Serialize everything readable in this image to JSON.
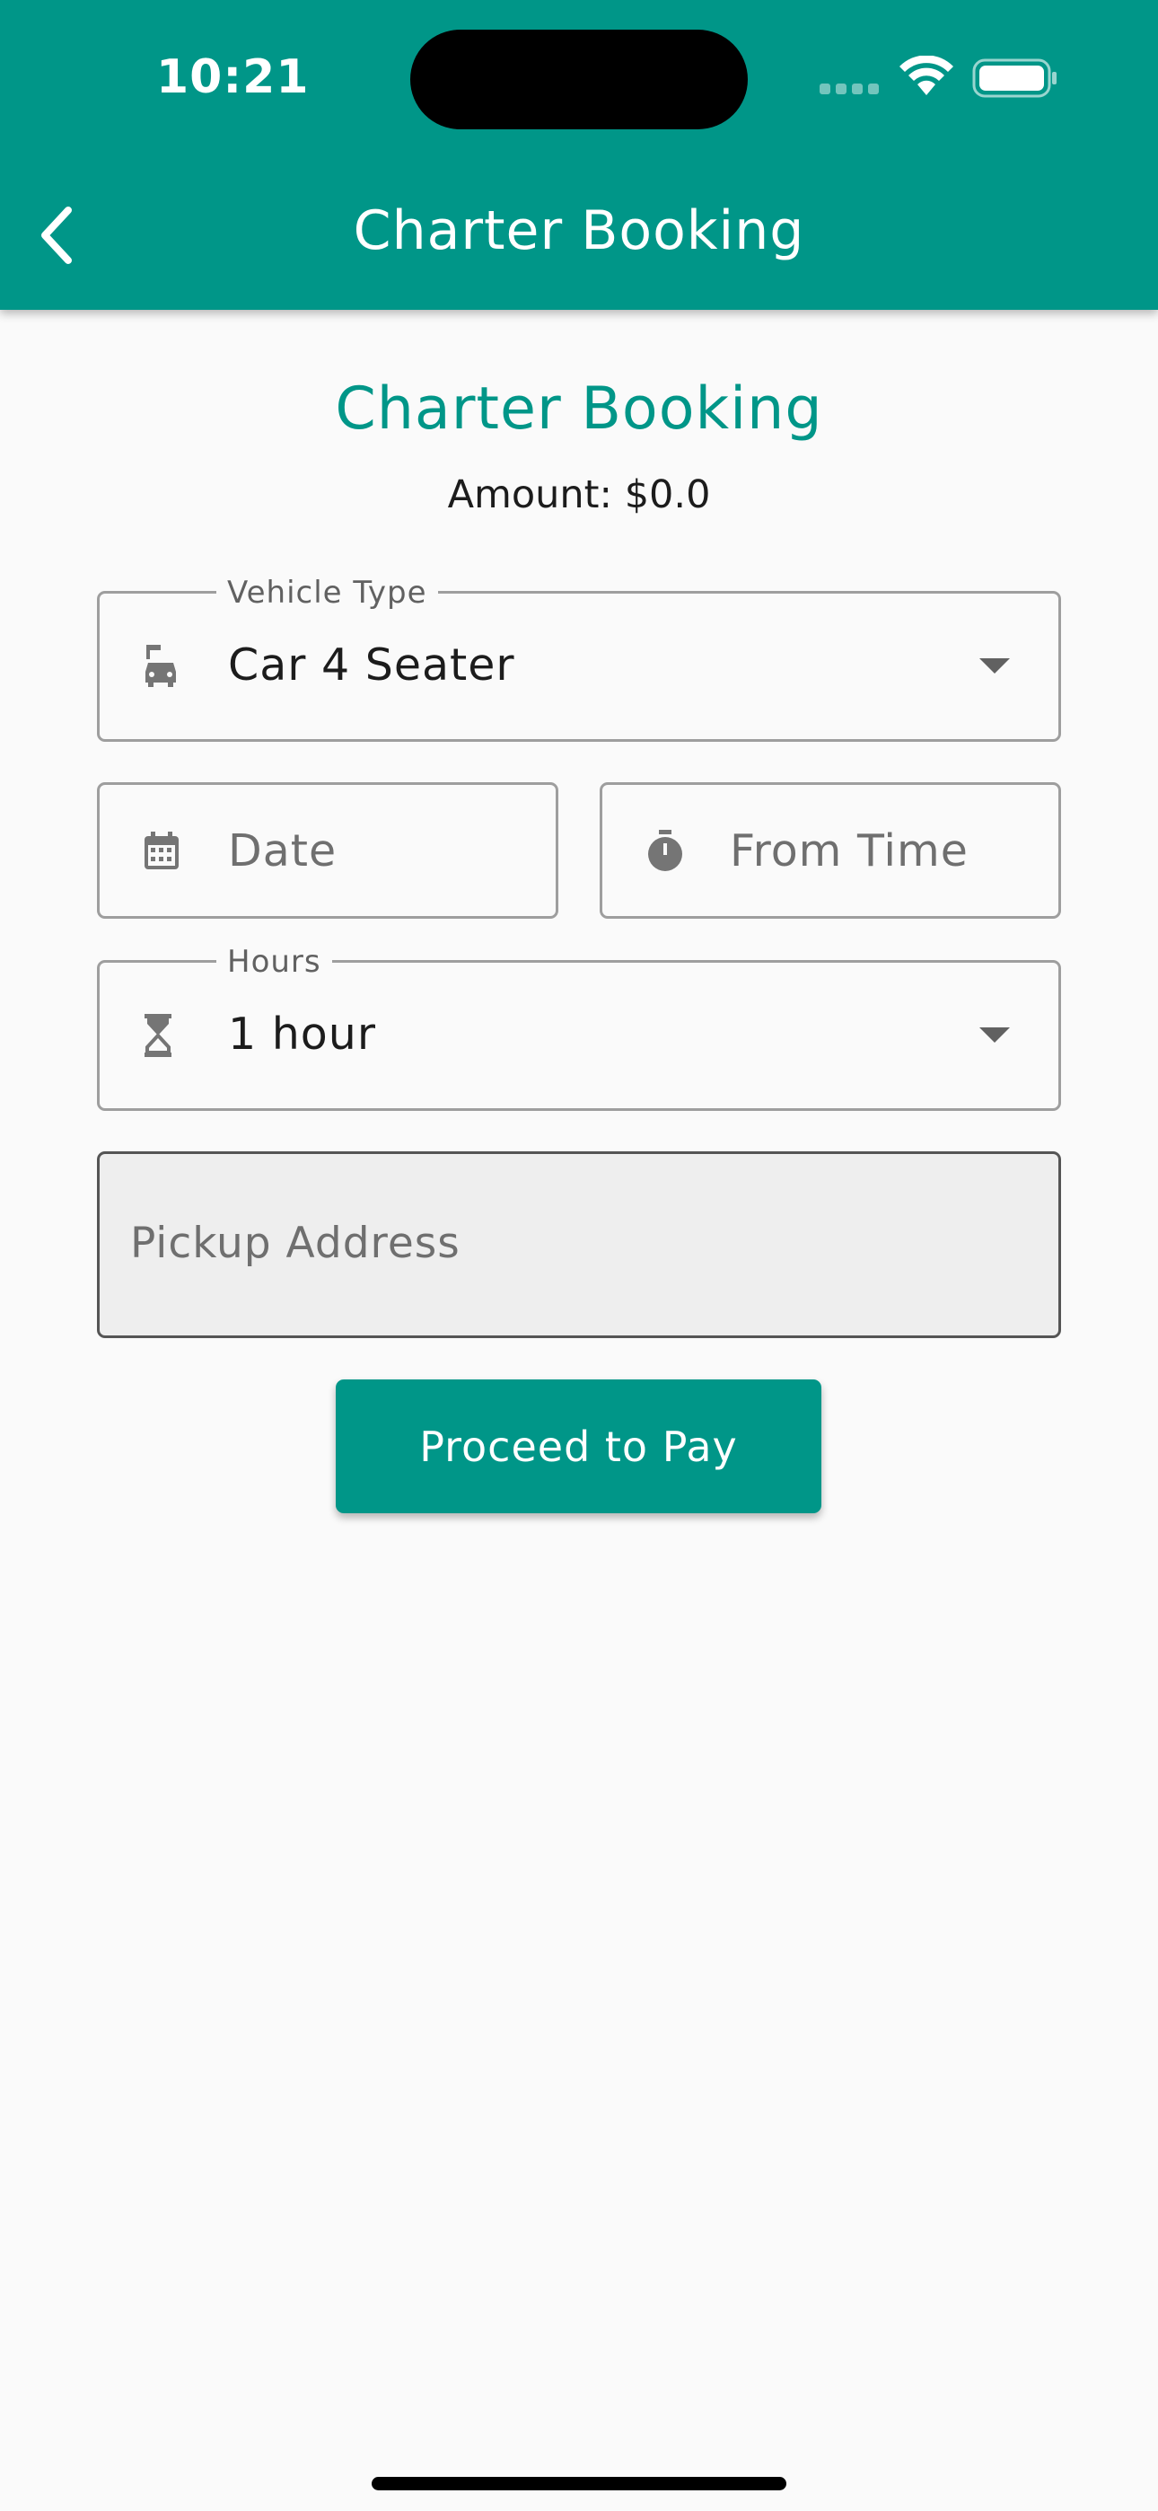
{
  "status_bar": {
    "time": "10:21"
  },
  "appbar": {
    "title": "Charter Booking",
    "back_icon": "chevron-left-icon"
  },
  "header": {
    "title": "Charter Booking",
    "amount": "Amount: $0.0"
  },
  "form": {
    "vehicle_type": {
      "label": "Vehicle Type",
      "value": "Car 4 Seater",
      "icon": "car-icon"
    },
    "date": {
      "placeholder": "Date",
      "icon": "calendar-icon"
    },
    "from_time": {
      "placeholder": "From Time",
      "icon": "stopwatch-icon"
    },
    "hours": {
      "label": "Hours",
      "value": "1 hour",
      "icon": "hourglass-icon"
    },
    "pickup_address": {
      "placeholder": "Pickup Address"
    }
  },
  "actions": {
    "proceed_label": "Proceed to Pay"
  },
  "colors": {
    "primary": "#009688",
    "background": "#fafafa",
    "icon_gray": "#757575"
  }
}
